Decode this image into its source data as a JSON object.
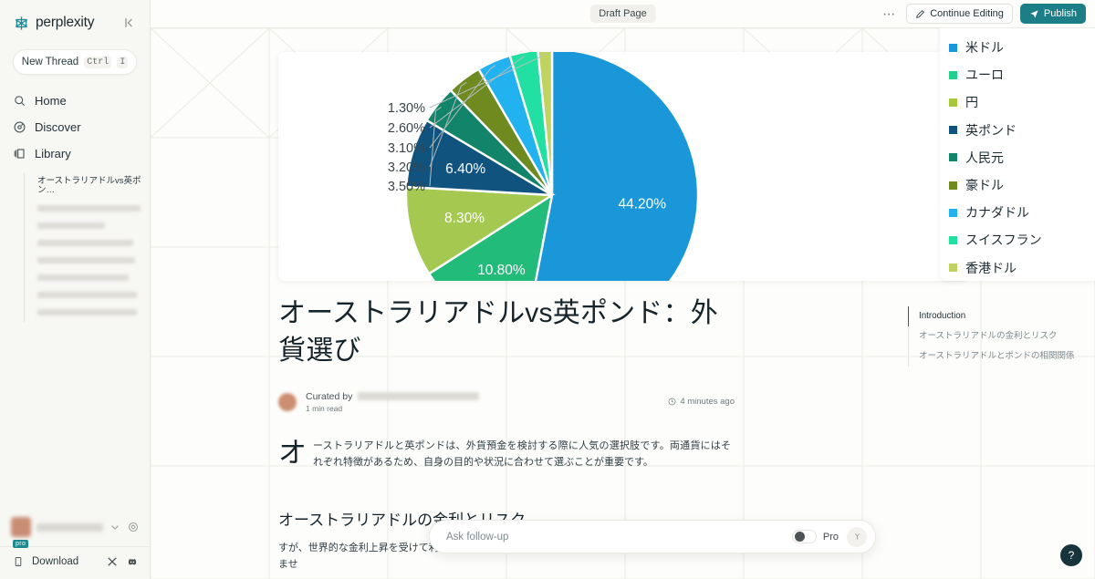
{
  "sidebar": {
    "brand": "perplexity",
    "collapse_icon": "panel-collapse-icon",
    "new_thread": {
      "label": "New Thread",
      "shortcut_key1": "Ctrl",
      "shortcut_key2": "I"
    },
    "nav": [
      {
        "label": "Home",
        "icon": "search-icon"
      },
      {
        "label": "Discover",
        "icon": "compass-icon"
      },
      {
        "label": "Library",
        "icon": "library-icon"
      }
    ],
    "threads": [
      {
        "label": "オーストラリアドルvs英ポン…",
        "redacted": false
      },
      {
        "label": "",
        "redacted": true
      },
      {
        "label": "",
        "redacted": true
      },
      {
        "label": "",
        "redacted": true
      },
      {
        "label": "",
        "redacted": true
      },
      {
        "label": "",
        "redacted": true
      },
      {
        "label": "",
        "redacted": true
      },
      {
        "label": "",
        "redacted": true
      }
    ],
    "user": {
      "name": "",
      "badge": "pro"
    },
    "download": {
      "label": "Download",
      "icons": [
        "x-twitter-icon",
        "discord-icon"
      ]
    }
  },
  "topbar": {
    "draft_chip": "Draft Page",
    "more_label": "⋯",
    "continue_editing": "Continue Editing",
    "publish": "Publish",
    "publish_color": "#1c7e86"
  },
  "chart_data": {
    "type": "pie",
    "title": "",
    "legend_position": "right",
    "labels": [
      "米ドル",
      "ユーロ",
      "円",
      "英ポンド",
      "人民元",
      "豪ドル",
      "カナダドル",
      "スイスフラン",
      "香港ドル"
    ],
    "values": [
      44.2,
      10.8,
      8.3,
      6.4,
      3.5,
      3.2,
      3.1,
      2.6,
      1.3
    ],
    "value_labels": [
      "44.20%",
      "10.80%",
      "8.30%",
      "6.40%",
      "3.50%",
      "3.20%",
      "3.10%",
      "2.60%",
      "1.30%"
    ],
    "colors": [
      "#1a97d8",
      "#22bb79",
      "#a5c850",
      "#10537e",
      "#12846a",
      "#6f8a1f",
      "#22b2f0",
      "#22e0a1",
      "#c0d25f"
    ],
    "legend_colors": [
      "#1a97d8",
      "#22d08e",
      "#a8c83c",
      "#10537e",
      "#12846a",
      "#6f8a1f",
      "#22b2f0",
      "#22e0a1",
      "#c0d25f"
    ]
  },
  "article": {
    "title": "オーストラリアドルvs英ポンド：外貨選び",
    "curated_by_label": "Curated by",
    "read_time": "1 min read",
    "timestamp": "4 minutes ago",
    "clock_icon": "clock-icon",
    "dropcap": "オ",
    "intro": "ーストラリアドルと英ポンドは、外貨預金を検討する際に人気の選択肢です。両通貨にはそれぞれ特徴があるため、自身の目的や状況に合わせて選ぶことが重要です。",
    "section_heading": "オーストラリアドルの金利とリスク",
    "section_text": "すが、世界的な金利上昇を受けて利下げ観測が後退しており、金利面での魅力は以前ほど大きくありませ"
  },
  "toc": [
    {
      "label": "Introduction",
      "active": true
    },
    {
      "label": "オーストラリアドルの金利とリスク",
      "active": false
    },
    {
      "label": "オーストラリアドルとポンドの相関関係",
      "active": false
    }
  ],
  "askbar": {
    "placeholder": "Ask follow-up",
    "value": "",
    "pro_label": "Pro",
    "pro_enabled": false,
    "attach_icon": "magic-wand-icon"
  },
  "help": {
    "label": "?"
  }
}
